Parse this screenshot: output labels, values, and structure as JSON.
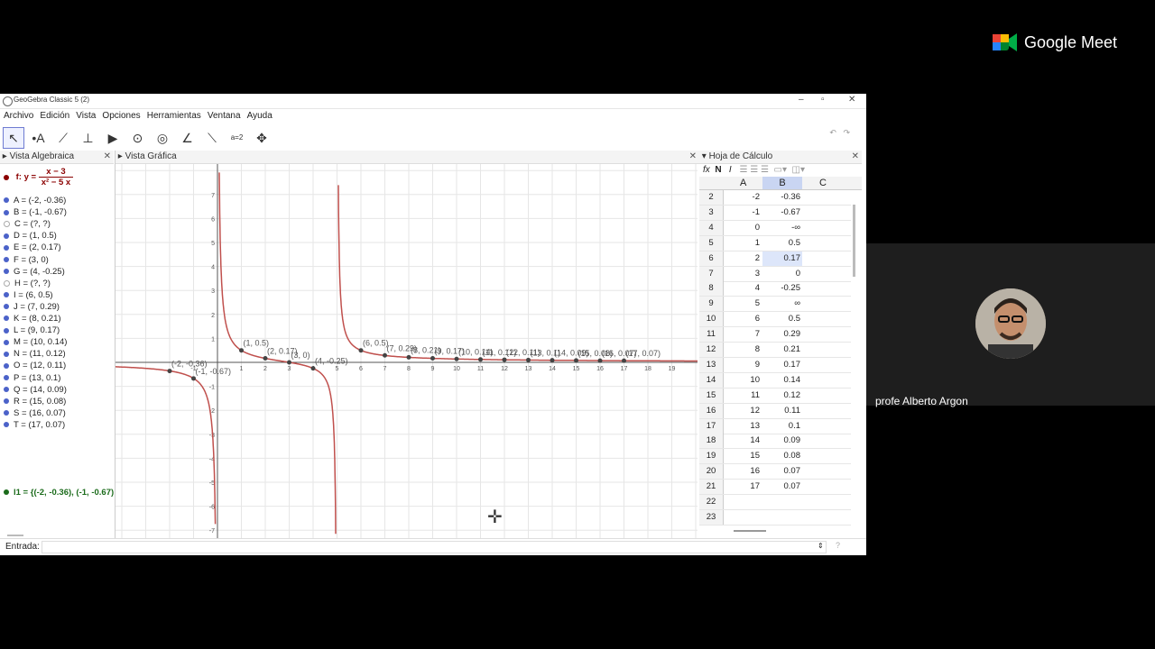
{
  "window": {
    "title": "GeoGebra Classic 5 (2)",
    "buttons": [
      "‒",
      "▫",
      "✕"
    ]
  },
  "menu": [
    "Archivo",
    "Edición",
    "Vista",
    "Opciones",
    "Herramientas",
    "Ventana",
    "Ayuda"
  ],
  "tools": [
    {
      "name": "move-tool",
      "glyph": "↖"
    },
    {
      "name": "point-tool",
      "glyph": "•A"
    },
    {
      "name": "line-tool",
      "glyph": "⟋"
    },
    {
      "name": "perpendicular-tool",
      "glyph": "⊥"
    },
    {
      "name": "polygon-tool",
      "glyph": "▶"
    },
    {
      "name": "circle-tool",
      "glyph": "⊙"
    },
    {
      "name": "ellipse-tool",
      "glyph": "◎"
    },
    {
      "name": "angle-tool",
      "glyph": "∠"
    },
    {
      "name": "reflect-tool",
      "glyph": "⟍"
    },
    {
      "name": "slider-tool",
      "glyph": "a=2"
    },
    {
      "name": "move-view-tool",
      "glyph": "✥"
    }
  ],
  "panels": {
    "algebra": "Vista Algebraica",
    "graphics": "Vista Gráfica",
    "spreadsheet": "Hoja de Cálculo"
  },
  "algebra": {
    "function": {
      "lhs": "f: y =",
      "num": "x − 3",
      "den": "x² − 5 x"
    },
    "points": [
      {
        "t": "A = (-2, -0.36)",
        "def": true
      },
      {
        "t": "B = (-1, -0.67)",
        "def": true
      },
      {
        "t": "C = (?, ?)",
        "def": false
      },
      {
        "t": "D = (1, 0.5)",
        "def": true
      },
      {
        "t": "E = (2, 0.17)",
        "def": true
      },
      {
        "t": "F = (3, 0)",
        "def": true
      },
      {
        "t": "G = (4, -0.25)",
        "def": true
      },
      {
        "t": "H = (?, ?)",
        "def": false
      },
      {
        "t": "I = (6, 0.5)",
        "def": true
      },
      {
        "t": "J = (7, 0.29)",
        "def": true
      },
      {
        "t": "K = (8, 0.21)",
        "def": true
      },
      {
        "t": "L = (9, 0.17)",
        "def": true
      },
      {
        "t": "M = (10, 0.14)",
        "def": true
      },
      {
        "t": "N = (11, 0.12)",
        "def": true
      },
      {
        "t": "O = (12, 0.11)",
        "def": true
      },
      {
        "t": "P = (13, 0.1)",
        "def": true
      },
      {
        "t": "Q = (14, 0.09)",
        "def": true
      },
      {
        "t": "R = (15, 0.08)",
        "def": true
      },
      {
        "t": "S = (16, 0.07)",
        "def": true
      },
      {
        "t": "T = (17, 0.07)",
        "def": true
      }
    ],
    "list": "l1 = {(-2, -0.36), (-1, -0.67)"
  },
  "graph": {
    "x_ticks": [
      "-1",
      "1",
      "2",
      "3",
      "4",
      "5",
      "6",
      "7",
      "8",
      "9",
      "10",
      "11",
      "12",
      "13",
      "14",
      "15",
      "16",
      "17",
      "18",
      "19"
    ],
    "y_ticks": [
      "7",
      "6",
      "5",
      "4",
      "3",
      "2",
      "1",
      "-1",
      "-2",
      "-3",
      "-4",
      "-5",
      "-6",
      "-7"
    ],
    "point_labels": [
      "(-2, -0.36)",
      "(-1, -0.67)",
      "(1, 0.5)",
      "(2, 0.17)",
      "(3, 0)",
      "(4, -0.25)",
      "(6, 0.5)",
      "(7, 0.29)",
      "(8, 0.21)",
      "(9, 0.17)",
      "(10, 0.14)",
      "(11, 0.12)",
      "(12, 0.11)",
      "(13, 0.1)",
      "(14, 0.09)",
      "(15, 0.08)",
      "(16, 0.07)",
      "(17, 0.07)"
    ],
    "curve_color": "#c0504d"
  },
  "sheet": {
    "toolbar": [
      "fx",
      "N",
      "I"
    ],
    "cols": [
      "A",
      "B",
      "C"
    ],
    "rows": [
      [
        "2",
        "-2",
        "-0.36"
      ],
      [
        "3",
        "-1",
        "-0.67"
      ],
      [
        "4",
        "0",
        "-∞"
      ],
      [
        "5",
        "1",
        "0.5"
      ],
      [
        "6",
        "2",
        "0.17"
      ],
      [
        "7",
        "3",
        "0"
      ],
      [
        "8",
        "4",
        "-0.25"
      ],
      [
        "9",
        "5",
        "∞"
      ],
      [
        "10",
        "6",
        "0.5"
      ],
      [
        "11",
        "7",
        "0.29"
      ],
      [
        "12",
        "8",
        "0.21"
      ],
      [
        "13",
        "9",
        "0.17"
      ],
      [
        "14",
        "10",
        "0.14"
      ],
      [
        "15",
        "11",
        "0.12"
      ],
      [
        "16",
        "12",
        "0.11"
      ],
      [
        "17",
        "13",
        "0.1"
      ],
      [
        "18",
        "14",
        "0.09"
      ],
      [
        "19",
        "15",
        "0.08"
      ],
      [
        "20",
        "16",
        "0.07"
      ],
      [
        "21",
        "17",
        "0.07"
      ],
      [
        "22",
        "",
        ""
      ],
      [
        "23",
        "",
        ""
      ]
    ],
    "selected_row": "6"
  },
  "input": {
    "label": "Entrada:"
  },
  "meet": {
    "brand": "Google Meet",
    "participant": "profe Alberto Argon"
  }
}
